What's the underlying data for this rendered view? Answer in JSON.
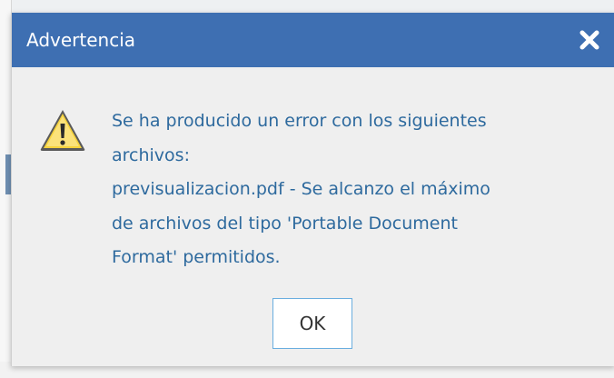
{
  "dialog": {
    "title": "Advertencia",
    "close_icon": "close-icon",
    "warning_icon": "warning-icon",
    "message_lines": [
      "Se ha producido un error con los siguientes",
      "archivos:",
      "previsualizacion.pdf - Se alcanzo el máximo",
      "de archivos del tipo 'Portable Document",
      "Format' permitidos."
    ],
    "ok_label": "OK"
  },
  "colors": {
    "title_bar": "#3e6fb2",
    "message_text": "#2e6a9e",
    "ok_border": "#6aaedf"
  }
}
